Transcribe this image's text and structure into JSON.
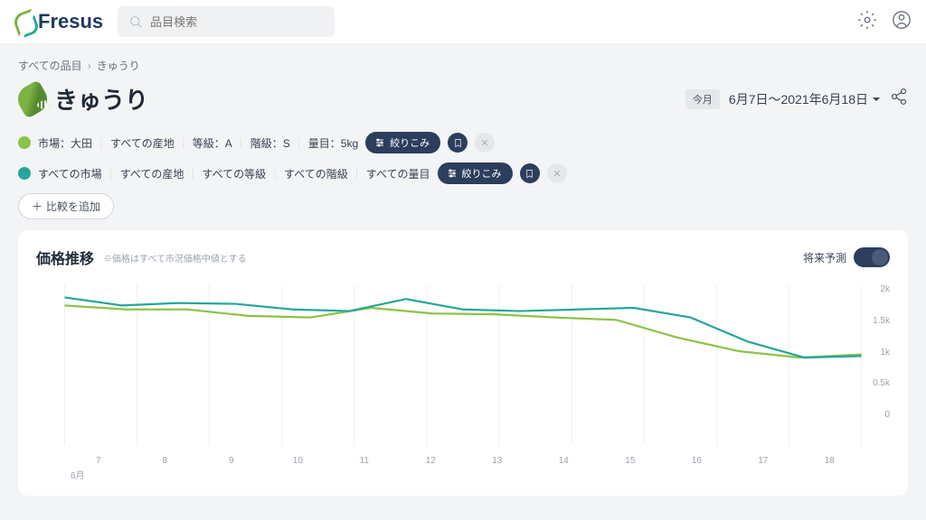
{
  "brand": "Fresus",
  "search": {
    "placeholder": "品目検索"
  },
  "breadcrumb": {
    "root": "すべての品目",
    "current": "きゅうり"
  },
  "title": "きゅうり",
  "date": {
    "badge": "今月",
    "range": "6月7日〜2021年6月18日"
  },
  "filters": [
    {
      "color": "#8bc34a",
      "parts": [
        "市場：大田",
        "すべての産地",
        "等級：A",
        "階級：S",
        "量目：5kg"
      ],
      "action": "絞りこみ"
    },
    {
      "color": "#26a69a",
      "parts": [
        "すべての市場",
        "すべての産地",
        "すべての等級",
        "すべての階級",
        "すべての量目"
      ],
      "action": "絞りこみ"
    }
  ],
  "addCompare": "比較を追加",
  "card": {
    "title": "価格推移",
    "note": "※価格はすべて市況価格中値とする",
    "toggleLabel": "将来予測"
  },
  "chart_data": {
    "type": "line",
    "x": [
      7,
      8,
      9,
      10,
      11,
      12,
      13,
      14,
      15,
      16,
      17,
      18
    ],
    "xlabel_month": "6月",
    "ylim": [
      0,
      2000
    ],
    "yticks": [
      "2k",
      "1.5k",
      "1k",
      "0.5k",
      "0"
    ],
    "series": [
      {
        "name": "大田 A/S/5kg",
        "color": "#8bc34a",
        "values": [
          1750,
          1700,
          1700,
          1620,
          1600,
          1720,
          1650,
          1640,
          1600,
          1570,
          1350,
          1180,
          1100,
          1140
        ]
      },
      {
        "name": "すべて",
        "color": "#26a69a",
        "values": [
          1850,
          1750,
          1780,
          1770,
          1700,
          1680,
          1830,
          1700,
          1680,
          1700,
          1720,
          1600,
          1300,
          1100,
          1120
        ]
      }
    ]
  }
}
